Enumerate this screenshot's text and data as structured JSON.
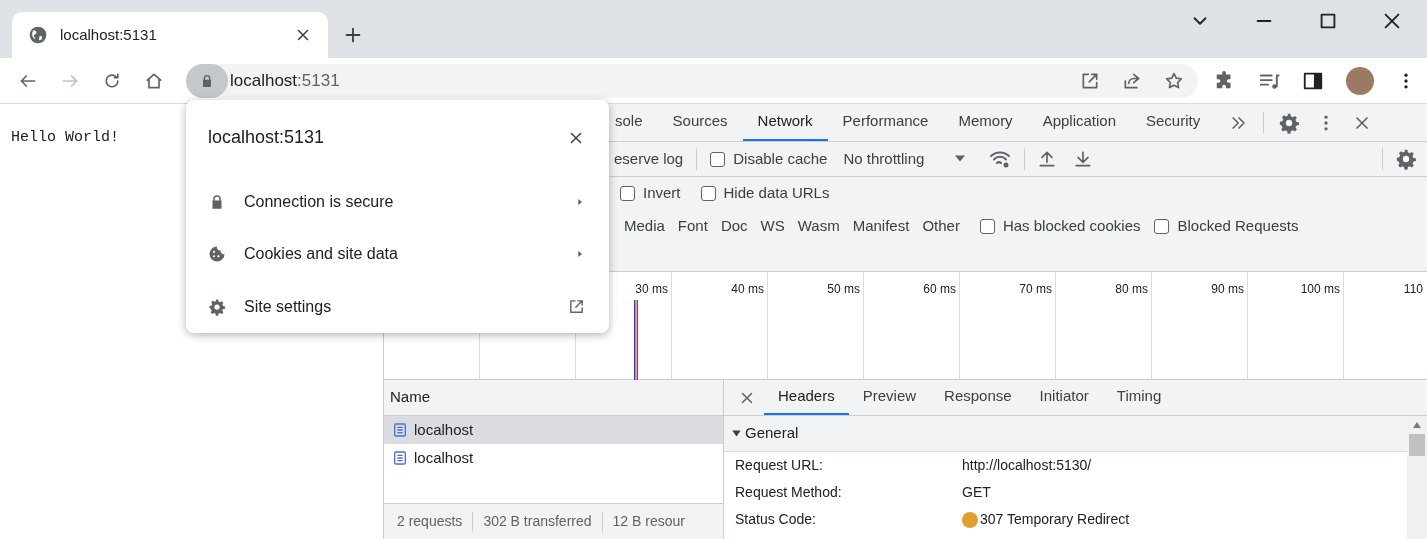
{
  "browser_tab": {
    "title": "localhost:5131"
  },
  "address_bar": {
    "host": "localhost",
    "port": ":5131"
  },
  "page": {
    "text": "Hello World!"
  },
  "site_info_popup": {
    "title": "localhost:5131",
    "items": [
      {
        "label": "Connection is secure",
        "kind": "submenu"
      },
      {
        "label": "Cookies and site data",
        "kind": "submenu"
      },
      {
        "label": "Site settings",
        "kind": "link"
      }
    ]
  },
  "devtools": {
    "tabs": [
      {
        "label": "sole",
        "selected": false
      },
      {
        "label": "Sources",
        "selected": false
      },
      {
        "label": "Network",
        "selected": true
      },
      {
        "label": "Performance",
        "selected": false
      },
      {
        "label": "Memory",
        "selected": false
      },
      {
        "label": "Application",
        "selected": false
      },
      {
        "label": "Security",
        "selected": false
      }
    ],
    "toolbar": {
      "preserve_log": "eserve log",
      "disable_cache": {
        "label": "Disable cache",
        "checked": false
      },
      "throttling": "No throttling"
    },
    "filter_checkboxes": [
      {
        "label": "Invert",
        "checked": false
      },
      {
        "label": "Hide data URLs",
        "checked": false
      }
    ],
    "resource_types": [
      "Media",
      "Font",
      "Doc",
      "WS",
      "Wasm",
      "Manifest",
      "Other"
    ],
    "type_checkboxes": [
      {
        "label": "Has blocked cookies",
        "checked": false
      },
      {
        "label": "Blocked Requests",
        "checked": false
      }
    ],
    "timeline": {
      "labels": [
        "30 ms",
        "40 ms",
        "50 ms",
        "60 ms",
        "70 ms",
        "80 ms",
        "90 ms",
        "100 ms",
        "110"
      ]
    },
    "requests": {
      "column": "Name",
      "rows": [
        {
          "name": "localhost",
          "selected": true
        },
        {
          "name": "localhost",
          "selected": false
        }
      ],
      "summary": [
        "2 requests",
        "302 B transferred",
        "12 B resour"
      ]
    },
    "details": {
      "tabs": [
        {
          "label": "Headers",
          "selected": true
        },
        {
          "label": "Preview",
          "selected": false
        },
        {
          "label": "Response",
          "selected": false
        },
        {
          "label": "Initiator",
          "selected": false
        },
        {
          "label": "Timing",
          "selected": false
        }
      ],
      "section": {
        "title": "General",
        "expanded": true
      },
      "fields": [
        {
          "label": "Request URL:",
          "value": "http://localhost:5130/"
        },
        {
          "label": "Request Method:",
          "value": "GET"
        },
        {
          "label": "Status Code:",
          "value": "307 Temporary Redirect",
          "color": "#e29d33"
        }
      ]
    }
  }
}
